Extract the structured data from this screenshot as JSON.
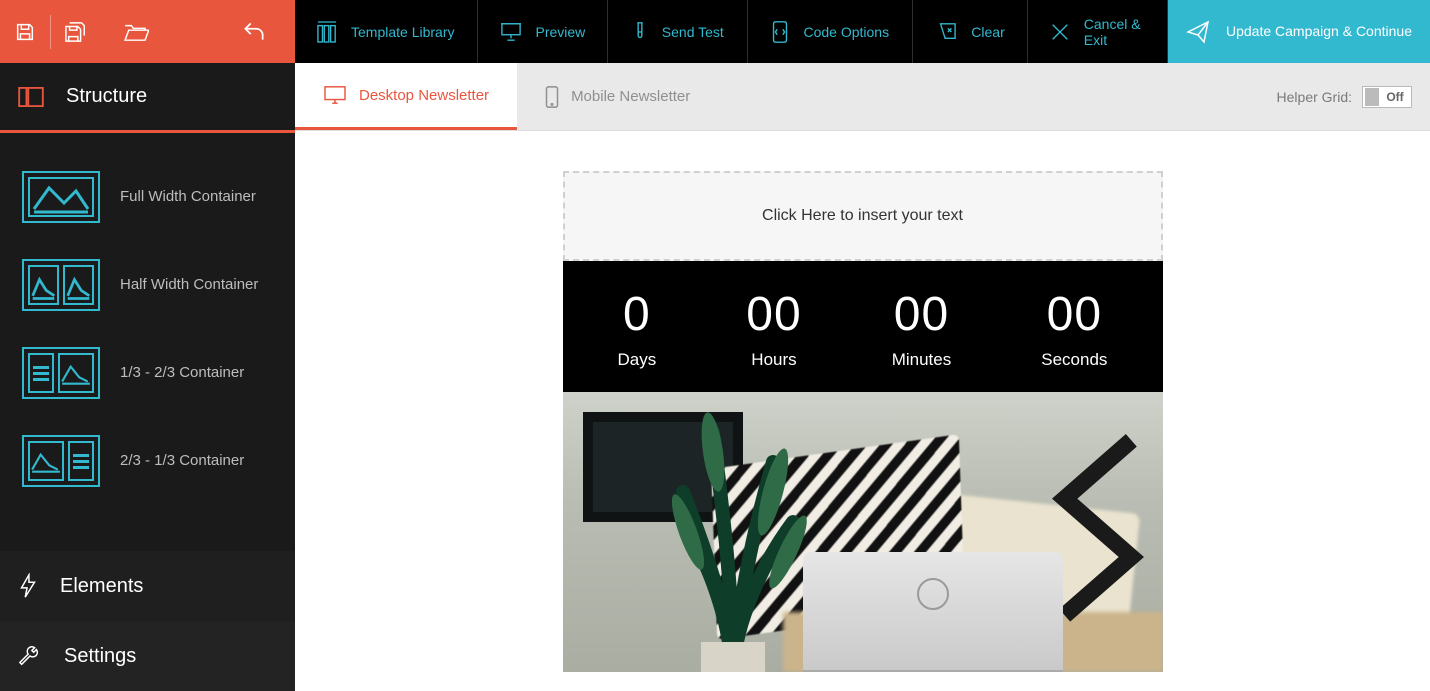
{
  "topbar": {
    "template_library": "Template Library",
    "preview": "Preview",
    "send_test": "Send Test",
    "code_options": "Code Options",
    "clear": "Clear",
    "cancel_exit": "Cancel & Exit",
    "update": "Update Campaign & Continue"
  },
  "sidebar": {
    "structure_title": "Structure",
    "elements_title": "Elements",
    "settings_title": "Settings",
    "items": [
      {
        "label": "Full Width Container"
      },
      {
        "label": "Half Width Container"
      },
      {
        "label": "1/3 - 2/3 Container"
      },
      {
        "label": "2/3 - 1/3 Container"
      }
    ]
  },
  "view_tabs": {
    "desktop": "Desktop Newsletter",
    "mobile": "Mobile Newsletter"
  },
  "helper_grid": {
    "label": "Helper Grid:",
    "state": "Off"
  },
  "canvas": {
    "placeholder": "Click Here to insert your text",
    "countdown": {
      "days_val": "0",
      "days_lbl": "Days",
      "hours_val": "00",
      "hours_lbl": "Hours",
      "minutes_val": "00",
      "minutes_lbl": "Minutes",
      "seconds_val": "00",
      "seconds_lbl": "Seconds"
    }
  },
  "colors": {
    "brand_red": "#e9563e",
    "accent_teal": "#32b9cf"
  }
}
